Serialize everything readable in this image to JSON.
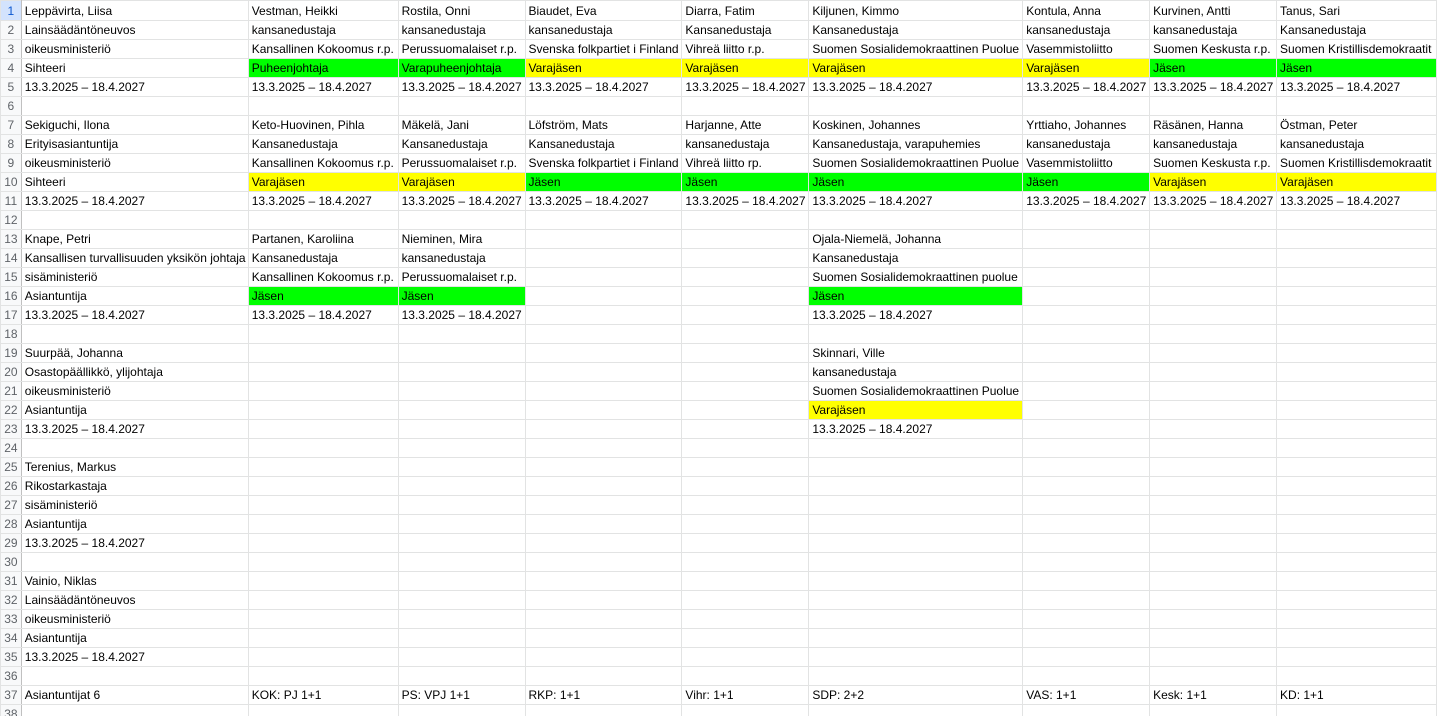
{
  "colors": {
    "green": "#00ff00",
    "yellow": "#ffff00"
  },
  "rows": [
    {
      "n": "1",
      "c": [
        {
          "t": "Leppävirta, Liisa"
        },
        {
          "t": "Vestman, Heikki"
        },
        {
          "t": "Rostila, Onni"
        },
        {
          "t": "Biaudet, Eva"
        },
        {
          "t": "Diarra, Fatim"
        },
        {
          "t": "Kiljunen, Kimmo"
        },
        {
          "t": "Kontula, Anna"
        },
        {
          "t": "Kurvinen, Antti"
        },
        {
          "t": "Tanus, Sari"
        }
      ]
    },
    {
      "n": "2",
      "c": [
        {
          "t": "Lainsäädäntöneuvos"
        },
        {
          "t": "kansanedustaja"
        },
        {
          "t": "kansanedustaja"
        },
        {
          "t": "kansanedustaja"
        },
        {
          "t": "Kansanedustaja"
        },
        {
          "t": "Kansanedustaja"
        },
        {
          "t": "kansanedustaja"
        },
        {
          "t": "kansanedustaja"
        },
        {
          "t": "Kansanedustaja"
        }
      ]
    },
    {
      "n": "3",
      "c": [
        {
          "t": "oikeusministeriö"
        },
        {
          "t": "Kansallinen Kokoomus r.p."
        },
        {
          "t": "Perussuomalaiset r.p."
        },
        {
          "t": "Svenska folkpartiet i Finland"
        },
        {
          "t": "Vihreä liitto r.p."
        },
        {
          "t": "Suomen Sosialidemokraattinen Puolue"
        },
        {
          "t": "Vasemmistoliitto"
        },
        {
          "t": "Suomen Keskusta r.p."
        },
        {
          "t": "Suomen Kristillisdemokraatit"
        }
      ]
    },
    {
      "n": "4",
      "c": [
        {
          "t": "Sihteeri"
        },
        {
          "t": "Puheenjohtaja",
          "bg": "g"
        },
        {
          "t": "Varapuheenjohtaja",
          "bg": "g"
        },
        {
          "t": "Varajäsen",
          "bg": "y"
        },
        {
          "t": "Varajäsen",
          "bg": "y"
        },
        {
          "t": "Varajäsen",
          "bg": "y"
        },
        {
          "t": "Varajäsen",
          "bg": "y"
        },
        {
          "t": "Jäsen",
          "bg": "g"
        },
        {
          "t": "Jäsen",
          "bg": "g"
        }
      ]
    },
    {
      "n": "5",
      "c": [
        {
          "t": "13.3.2025 – 18.4.2027"
        },
        {
          "t": "13.3.2025 – 18.4.2027"
        },
        {
          "t": "13.3.2025 – 18.4.2027"
        },
        {
          "t": "13.3.2025 – 18.4.2027"
        },
        {
          "t": "13.3.2025 – 18.4.2027"
        },
        {
          "t": "13.3.2025 – 18.4.2027"
        },
        {
          "t": "13.3.2025 – 18.4.2027"
        },
        {
          "t": "13.3.2025 – 18.4.2027"
        },
        {
          "t": "13.3.2025 – 18.4.2027"
        }
      ]
    },
    {
      "n": "6",
      "c": [
        {},
        {},
        {},
        {},
        {},
        {},
        {},
        {},
        {}
      ]
    },
    {
      "n": "7",
      "c": [
        {
          "t": "Sekiguchi, Ilona"
        },
        {
          "t": "Keto-Huovinen, Pihla"
        },
        {
          "t": "Mäkelä, Jani"
        },
        {
          "t": "Löfström, Mats"
        },
        {
          "t": "Harjanne, Atte"
        },
        {
          "t": "Koskinen, Johannes"
        },
        {
          "t": "Yrttiaho, Johannes"
        },
        {
          "t": "Räsänen, Hanna"
        },
        {
          "t": "Östman, Peter"
        }
      ]
    },
    {
      "n": "8",
      "c": [
        {
          "t": "Erityisasiantuntija"
        },
        {
          "t": "Kansanedustaja"
        },
        {
          "t": "Kansanedustaja"
        },
        {
          "t": "Kansanedustaja"
        },
        {
          "t": "kansanedustaja"
        },
        {
          "t": "Kansanedustaja, varapuhemies"
        },
        {
          "t": "kansanedustaja"
        },
        {
          "t": "kansanedustaja"
        },
        {
          "t": "kansanedustaja"
        }
      ]
    },
    {
      "n": "9",
      "c": [
        {
          "t": "oikeusministeriö"
        },
        {
          "t": "Kansallinen Kokoomus r.p."
        },
        {
          "t": "Perussuomalaiset r.p."
        },
        {
          "t": "Svenska folkpartiet i Finland"
        },
        {
          "t": "Vihreä liitto rp."
        },
        {
          "t": "Suomen Sosialidemokraattinen Puolue"
        },
        {
          "t": "Vasemmistoliitto"
        },
        {
          "t": "Suomen Keskusta r.p."
        },
        {
          "t": "Suomen Kristillisdemokraatit"
        }
      ]
    },
    {
      "n": "10",
      "c": [
        {
          "t": "Sihteeri"
        },
        {
          "t": "Varajäsen",
          "bg": "y"
        },
        {
          "t": "Varajäsen",
          "bg": "y"
        },
        {
          "t": "Jäsen",
          "bg": "g"
        },
        {
          "t": "Jäsen",
          "bg": "g"
        },
        {
          "t": "Jäsen",
          "bg": "g"
        },
        {
          "t": "Jäsen",
          "bg": "g"
        },
        {
          "t": "Varajäsen",
          "bg": "y"
        },
        {
          "t": "Varajäsen",
          "bg": "y"
        }
      ]
    },
    {
      "n": "11",
      "c": [
        {
          "t": "13.3.2025 – 18.4.2027"
        },
        {
          "t": "13.3.2025 – 18.4.2027"
        },
        {
          "t": "13.3.2025 – 18.4.2027"
        },
        {
          "t": "13.3.2025 – 18.4.2027"
        },
        {
          "t": "13.3.2025 – 18.4.2027"
        },
        {
          "t": "13.3.2025 – 18.4.2027"
        },
        {
          "t": "13.3.2025 – 18.4.2027"
        },
        {
          "t": "13.3.2025 – 18.4.2027"
        },
        {
          "t": "13.3.2025 – 18.4.2027"
        }
      ]
    },
    {
      "n": "12",
      "c": [
        {},
        {},
        {},
        {},
        {},
        {},
        {},
        {},
        {}
      ]
    },
    {
      "n": "13",
      "c": [
        {
          "t": "Knape, Petri"
        },
        {
          "t": "Partanen, Karoliina"
        },
        {
          "t": "Nieminen, Mira"
        },
        {},
        {},
        {
          "t": "Ojala-Niemelä, Johanna"
        },
        {},
        {},
        {}
      ]
    },
    {
      "n": "14",
      "c": [
        {
          "t": "Kansallisen turvallisuuden yksikön johtaja"
        },
        {
          "t": "Kansanedustaja"
        },
        {
          "t": "kansanedustaja"
        },
        {},
        {},
        {
          "t": "Kansanedustaja"
        },
        {},
        {},
        {}
      ]
    },
    {
      "n": "15",
      "c": [
        {
          "t": "sisäministeriö"
        },
        {
          "t": "Kansallinen Kokoomus r.p."
        },
        {
          "t": "Perussuomalaiset r.p."
        },
        {},
        {},
        {
          "t": "Suomen Sosialidemokraattinen puolue"
        },
        {},
        {},
        {}
      ]
    },
    {
      "n": "16",
      "c": [
        {
          "t": "Asiantuntija"
        },
        {
          "t": "Jäsen",
          "bg": "g"
        },
        {
          "t": "Jäsen",
          "bg": "g"
        },
        {},
        {},
        {
          "t": "Jäsen",
          "bg": "g"
        },
        {},
        {},
        {}
      ]
    },
    {
      "n": "17",
      "c": [
        {
          "t": "13.3.2025 – 18.4.2027"
        },
        {
          "t": "13.3.2025 – 18.4.2027"
        },
        {
          "t": "13.3.2025 – 18.4.2027"
        },
        {},
        {},
        {
          "t": "13.3.2025 – 18.4.2027"
        },
        {},
        {},
        {}
      ]
    },
    {
      "n": "18",
      "c": [
        {},
        {},
        {},
        {},
        {},
        {},
        {},
        {},
        {}
      ]
    },
    {
      "n": "19",
      "c": [
        {
          "t": "Suurpää, Johanna"
        },
        {},
        {},
        {},
        {},
        {
          "t": "Skinnari, Ville"
        },
        {},
        {},
        {}
      ]
    },
    {
      "n": "20",
      "c": [
        {
          "t": "Osastopäällikkö, ylijohtaja"
        },
        {},
        {},
        {},
        {},
        {
          "t": "kansanedustaja"
        },
        {},
        {},
        {}
      ]
    },
    {
      "n": "21",
      "c": [
        {
          "t": "oikeusministeriö"
        },
        {},
        {},
        {},
        {},
        {
          "t": "Suomen Sosialidemokraattinen Puolue"
        },
        {},
        {},
        {}
      ]
    },
    {
      "n": "22",
      "c": [
        {
          "t": "Asiantuntija"
        },
        {},
        {},
        {},
        {},
        {
          "t": "Varajäsen",
          "bg": "y"
        },
        {},
        {},
        {}
      ]
    },
    {
      "n": "23",
      "c": [
        {
          "t": "13.3.2025 – 18.4.2027"
        },
        {},
        {},
        {},
        {},
        {
          "t": "13.3.2025 – 18.4.2027"
        },
        {},
        {},
        {}
      ]
    },
    {
      "n": "24",
      "c": [
        {},
        {},
        {},
        {},
        {},
        {},
        {},
        {},
        {}
      ]
    },
    {
      "n": "25",
      "c": [
        {
          "t": "Terenius, Markus"
        },
        {},
        {},
        {},
        {},
        {},
        {},
        {},
        {}
      ]
    },
    {
      "n": "26",
      "c": [
        {
          "t": "Rikostarkastaja"
        },
        {},
        {},
        {},
        {},
        {},
        {},
        {},
        {}
      ]
    },
    {
      "n": "27",
      "c": [
        {
          "t": "sisäministeriö"
        },
        {},
        {},
        {},
        {},
        {},
        {},
        {},
        {}
      ]
    },
    {
      "n": "28",
      "c": [
        {
          "t": "Asiantuntija"
        },
        {},
        {},
        {},
        {},
        {},
        {},
        {},
        {}
      ]
    },
    {
      "n": "29",
      "c": [
        {
          "t": "13.3.2025 – 18.4.2027"
        },
        {},
        {},
        {},
        {},
        {},
        {},
        {},
        {}
      ]
    },
    {
      "n": "30",
      "c": [
        {},
        {},
        {},
        {},
        {},
        {},
        {},
        {},
        {}
      ]
    },
    {
      "n": "31",
      "c": [
        {
          "t": "Vainio, Niklas"
        },
        {},
        {},
        {},
        {},
        {},
        {},
        {},
        {}
      ]
    },
    {
      "n": "32",
      "c": [
        {
          "t": "Lainsäädäntöneuvos"
        },
        {},
        {},
        {},
        {},
        {},
        {},
        {},
        {}
      ]
    },
    {
      "n": "33",
      "c": [
        {
          "t": "oikeusministeriö"
        },
        {},
        {},
        {},
        {},
        {},
        {},
        {},
        {}
      ]
    },
    {
      "n": "34",
      "c": [
        {
          "t": "Asiantuntija"
        },
        {},
        {},
        {},
        {},
        {},
        {},
        {},
        {}
      ]
    },
    {
      "n": "35",
      "c": [
        {
          "t": "13.3.2025 – 18.4.2027"
        },
        {},
        {},
        {},
        {},
        {},
        {},
        {},
        {}
      ]
    },
    {
      "n": "36",
      "c": [
        {},
        {},
        {},
        {},
        {},
        {},
        {},
        {},
        {}
      ]
    },
    {
      "n": "37",
      "c": [
        {
          "t": "Asiantuntijat 6"
        },
        {
          "t": "KOK: PJ 1+1"
        },
        {
          "t": "PS: VPJ 1+1"
        },
        {
          "t": "RKP: 1+1"
        },
        {
          "t": "Vihr: 1+1"
        },
        {
          "t": "SDP: 2+2"
        },
        {
          "t": "VAS: 1+1"
        },
        {
          "t": "Kesk: 1+1"
        },
        {
          "t": "KD: 1+1"
        }
      ]
    },
    {
      "n": "38",
      "c": [
        {},
        {},
        {},
        {},
        {},
        {},
        {},
        {},
        {}
      ]
    }
  ]
}
